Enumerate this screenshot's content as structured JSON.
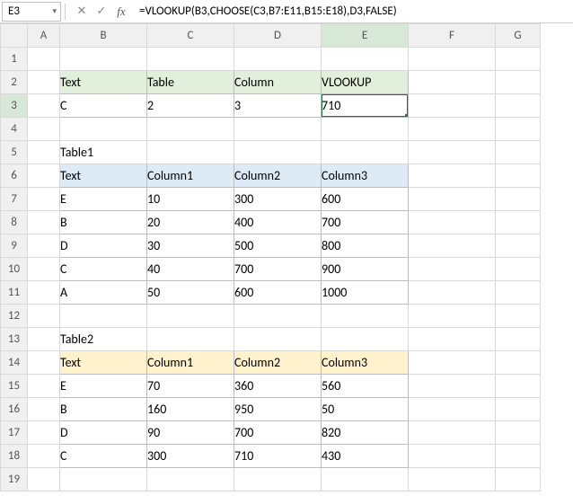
{
  "nameBox": "E3",
  "formula": "=VLOOKUP(B3,CHOOSE(C3,B7:E11,B15:E18),D3,FALSE)",
  "columns": [
    "A",
    "B",
    "C",
    "D",
    "E",
    "F",
    "G"
  ],
  "rows": [
    "1",
    "2",
    "3",
    "4",
    "5",
    "6",
    "7",
    "8",
    "9",
    "10",
    "11",
    "12",
    "13",
    "14",
    "15",
    "16",
    "17",
    "18",
    "19"
  ],
  "top": {
    "headers": [
      "Text",
      "Table",
      "Column",
      "VLOOKUP"
    ],
    "row": [
      "C",
      "2",
      "3",
      "710"
    ]
  },
  "table1": {
    "title": "Table1",
    "headers": [
      "Text",
      "Column1",
      "Column2",
      "Column3"
    ],
    "rows": [
      [
        "E",
        "10",
        "300",
        "600"
      ],
      [
        "B",
        "20",
        "400",
        "700"
      ],
      [
        "D",
        "30",
        "500",
        "800"
      ],
      [
        "C",
        "40",
        "700",
        "900"
      ],
      [
        "A",
        "50",
        "600",
        "1000"
      ]
    ]
  },
  "table2": {
    "title": "Table2",
    "headers": [
      "Text",
      "Column1",
      "Column2",
      "Column3"
    ],
    "rows": [
      [
        "E",
        "70",
        "360",
        "560"
      ],
      [
        "B",
        "160",
        "950",
        "50"
      ],
      [
        "D",
        "90",
        "700",
        "820"
      ],
      [
        "C",
        "300",
        "710",
        "430"
      ]
    ]
  },
  "chart_data": {
    "type": "table",
    "inputs": {
      "Text": "C",
      "Table": 2,
      "Column": 3
    },
    "result": 710,
    "tables": [
      {
        "name": "Table1",
        "columns": [
          "Text",
          "Column1",
          "Column2",
          "Column3"
        ],
        "rows": [
          [
            "E",
            10,
            300,
            600
          ],
          [
            "B",
            20,
            400,
            700
          ],
          [
            "D",
            30,
            500,
            800
          ],
          [
            "C",
            40,
            700,
            900
          ],
          [
            "A",
            50,
            600,
            1000
          ]
        ]
      },
      {
        "name": "Table2",
        "columns": [
          "Text",
          "Column1",
          "Column2",
          "Column3"
        ],
        "rows": [
          [
            "E",
            70,
            360,
            560
          ],
          [
            "B",
            160,
            950,
            50
          ],
          [
            "D",
            90,
            700,
            820
          ],
          [
            "C",
            300,
            710,
            430
          ]
        ]
      }
    ]
  }
}
